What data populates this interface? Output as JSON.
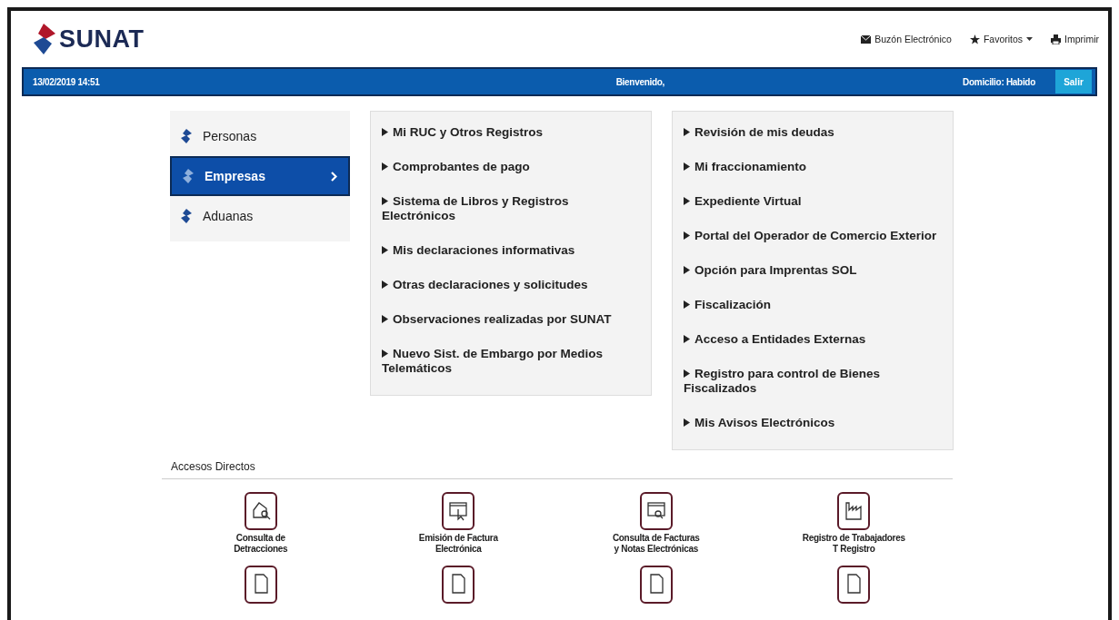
{
  "header": {
    "logo": "SUNAT",
    "links": [
      {
        "kind": "mail",
        "label": "Buzón Electrónico"
      },
      {
        "kind": "star",
        "label": "Favoritos",
        "dropdown": true
      },
      {
        "kind": "print",
        "label": "Imprimir"
      }
    ]
  },
  "bar": {
    "datetime": "13/02/2019 14:51",
    "welcome": "Bienvenido,",
    "domicilio": "Domicilio: Habido",
    "logout": "Salir"
  },
  "categories": [
    {
      "label": "Personas",
      "selected": false
    },
    {
      "label": "Empresas",
      "selected": true
    },
    {
      "label": "Aduanas",
      "selected": false
    }
  ],
  "menu_columns": [
    [
      "Mi RUC y Otros Registros",
      "Comprobantes de pago",
      "Sistema de Libros y Registros Electrónicos",
      "Mis declaraciones informativas",
      "Otras declaraciones y solicitudes",
      "Observaciones realizadas por SUNAT",
      "Nuevo Sist. de Embargo por Medios Telemáticos"
    ],
    [
      "Revisión de mis deudas",
      "Mi fraccionamiento",
      "Expediente Virtual",
      "Portal del Operador de Comercio Exterior",
      "Opción para Imprentas SOL",
      "Fiscalización",
      "Acceso a Entidades Externas",
      "Registro para control de Bienes Fiscalizados",
      "Mis Avisos Electrónicos"
    ]
  ],
  "accesos": {
    "title": "Accesos Directos",
    "items": [
      {
        "kind": "house-search",
        "label": "Consulta de\nDetracciones"
      },
      {
        "kind": "window-cursor",
        "label": "Emisión de Factura\nElectrónica"
      },
      {
        "kind": "window-search",
        "label": "Consulta de Facturas\ny Notas Electrónicas"
      },
      {
        "kind": "factory",
        "label": "Registro de Trabajadores\nT Registro"
      },
      {
        "kind": "document"
      },
      {
        "kind": "document"
      },
      {
        "kind": "document"
      },
      {
        "kind": "document"
      }
    ]
  }
}
